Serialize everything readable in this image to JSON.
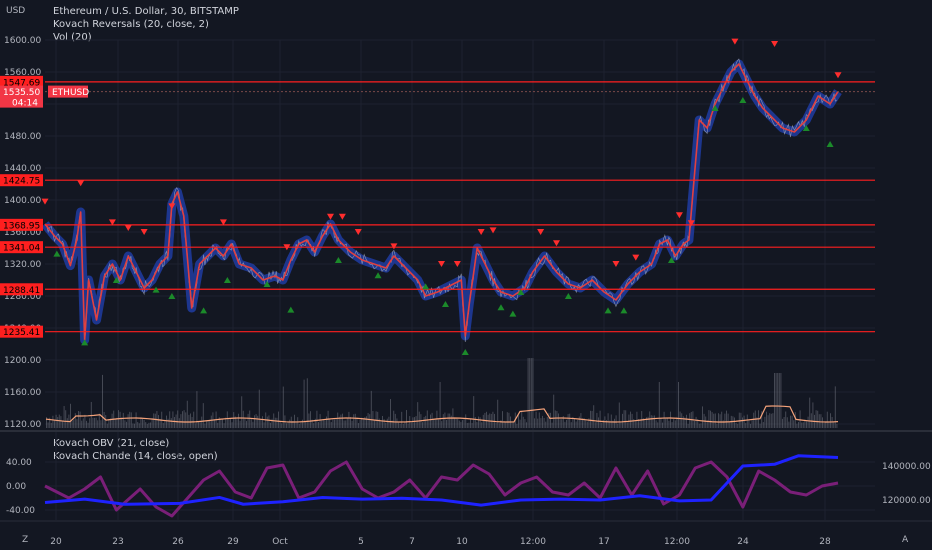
{
  "header": {
    "currency": "USD",
    "symbol_line": "Ethereum / U.S. Dollar, 30, BITSTAMP",
    "indicator_1": "Kovach Reversals (20, close, 2)",
    "indicator_2": "Vol (20)",
    "lower_indicator_1": "Kovach OBV (21, close)",
    "lower_indicator_2": "Kovach Chande (14, close, open)"
  },
  "footer": {
    "left_icon_label": "Z",
    "right_icon_label": "A"
  },
  "colors": {
    "background": "#131722",
    "grid": "#1e2230",
    "axis_text": "#b2b5be",
    "level_line": "#ff1f1f",
    "price_line": "#e04040",
    "band": "#1f3a9a",
    "down_marker": "#ff2d2d",
    "up_marker": "#1b8a2a",
    "volume": "#787b86",
    "volume_ma": "#f5a27a",
    "obv_line": "#1e22ff",
    "chande_line": "#7a1f78"
  },
  "chart_data": [
    {
      "type": "line",
      "title": "Ethereum / U.S. Dollar, 30, BITSTAMP",
      "ylabel": "USD",
      "ylim": [
        1120,
        1620
      ],
      "y_ticks": [
        "1600.00",
        "1560.00",
        "1520.00",
        "1480.00",
        "1440.00",
        "1400.00",
        "1360.00",
        "1320.00",
        "1280.00",
        "1240.00",
        "1200.00",
        "1160.00",
        "1120.00"
      ],
      "x_ticks": [
        "20",
        "23",
        "26",
        "29",
        "Oct",
        "5",
        "7",
        "10",
        "12:00",
        "17",
        "12:00",
        "24",
        "28"
      ],
      "horizontal_levels": [
        {
          "label": "1547.69",
          "value": 1547.69
        },
        {
          "label": "1424.75",
          "value": 1424.75
        },
        {
          "label": "1368.95",
          "value": 1368.95
        },
        {
          "label": "1341.04",
          "value": 1341.04
        },
        {
          "label": "1288.41",
          "value": 1288.41
        },
        {
          "label": "1235.41",
          "value": 1235.41
        }
      ],
      "last_price": {
        "symbol": "ETHUSD",
        "value": 1535.5,
        "label": "1535.50",
        "countdown": "04:14"
      },
      "series": [
        {
          "name": "ETHUSD",
          "points": [
            [
              0,
              1370
            ],
            [
              0.012,
              1355
            ],
            [
              0.022,
              1345
            ],
            [
              0.032,
              1318
            ],
            [
              0.04,
              1350
            ],
            [
              0.045,
              1385
            ],
            [
              0.05,
              1225
            ],
            [
              0.055,
              1300
            ],
            [
              0.065,
              1250
            ],
            [
              0.075,
              1305
            ],
            [
              0.085,
              1320
            ],
            [
              0.095,
              1300
            ],
            [
              0.105,
              1330
            ],
            [
              0.115,
              1310
            ],
            [
              0.125,
              1290
            ],
            [
              0.135,
              1300
            ],
            [
              0.145,
              1320
            ],
            [
              0.155,
              1330
            ],
            [
              0.16,
              1395
            ],
            [
              0.167,
              1410
            ],
            [
              0.175,
              1380
            ],
            [
              0.185,
              1265
            ],
            [
              0.195,
              1320
            ],
            [
              0.205,
              1330
            ],
            [
              0.215,
              1340
            ],
            [
              0.225,
              1330
            ],
            [
              0.235,
              1345
            ],
            [
              0.245,
              1320
            ],
            [
              0.26,
              1315
            ],
            [
              0.275,
              1300
            ],
            [
              0.29,
              1305
            ],
            [
              0.3,
              1300
            ],
            [
              0.31,
              1325
            ],
            [
              0.32,
              1345
            ],
            [
              0.33,
              1350
            ],
            [
              0.34,
              1335
            ],
            [
              0.35,
              1355
            ],
            [
              0.36,
              1370
            ],
            [
              0.37,
              1350
            ],
            [
              0.385,
              1335
            ],
            [
              0.4,
              1325
            ],
            [
              0.415,
              1320
            ],
            [
              0.43,
              1315
            ],
            [
              0.44,
              1330
            ],
            [
              0.455,
              1315
            ],
            [
              0.47,
              1300
            ],
            [
              0.48,
              1280
            ],
            [
              0.495,
              1285
            ],
            [
              0.505,
              1290
            ],
            [
              0.515,
              1295
            ],
            [
              0.525,
              1300
            ],
            [
              0.53,
              1230
            ],
            [
              0.535,
              1270
            ],
            [
              0.545,
              1340
            ],
            [
              0.555,
              1320
            ],
            [
              0.565,
              1300
            ],
            [
              0.575,
              1285
            ],
            [
              0.59,
              1280
            ],
            [
              0.605,
              1290
            ],
            [
              0.615,
              1310
            ],
            [
              0.63,
              1330
            ],
            [
              0.645,
              1310
            ],
            [
              0.66,
              1295
            ],
            [
              0.675,
              1290
            ],
            [
              0.69,
              1300
            ],
            [
              0.705,
              1285
            ],
            [
              0.72,
              1275
            ],
            [
              0.735,
              1295
            ],
            [
              0.75,
              1310
            ],
            [
              0.765,
              1320
            ],
            [
              0.775,
              1345
            ],
            [
              0.785,
              1350
            ],
            [
              0.795,
              1330
            ],
            [
              0.805,
              1345
            ],
            [
              0.812,
              1350
            ],
            [
              0.818,
              1420
            ],
            [
              0.825,
              1500
            ],
            [
              0.835,
              1490
            ],
            [
              0.845,
              1520
            ],
            [
              0.855,
              1540
            ],
            [
              0.865,
              1560
            ],
            [
              0.875,
              1570
            ],
            [
              0.885,
              1550
            ],
            [
              0.895,
              1530
            ],
            [
              0.905,
              1515
            ],
            [
              0.915,
              1505
            ],
            [
              0.93,
              1490
            ],
            [
              0.945,
              1485
            ],
            [
              0.96,
              1500
            ],
            [
              0.975,
              1530
            ],
            [
              0.99,
              1520
            ],
            [
              1,
              1535.5
            ]
          ]
        }
      ],
      "markers": {
        "down": [
          [
            0,
            1398
          ],
          [
            0.045,
            1421
          ],
          [
            0.085,
            1372
          ],
          [
            0.105,
            1365
          ],
          [
            0.125,
            1360
          ],
          [
            0.16,
            1392
          ],
          [
            0.225,
            1372
          ],
          [
            0.305,
            1341
          ],
          [
            0.36,
            1379
          ],
          [
            0.375,
            1379
          ],
          [
            0.395,
            1360
          ],
          [
            0.44,
            1342
          ],
          [
            0.5,
            1320
          ],
          [
            0.52,
            1320
          ],
          [
            0.55,
            1360
          ],
          [
            0.565,
            1362
          ],
          [
            0.625,
            1360
          ],
          [
            0.645,
            1346
          ],
          [
            0.72,
            1320
          ],
          [
            0.745,
            1328
          ],
          [
            0.8,
            1381
          ],
          [
            0.815,
            1371
          ],
          [
            0.87,
            1598
          ],
          [
            0.92,
            1595
          ],
          [
            1,
            1556
          ]
        ],
        "up": [
          [
            0.015,
            1333
          ],
          [
            0.05,
            1222
          ],
          [
            0.09,
            1300
          ],
          [
            0.14,
            1288
          ],
          [
            0.16,
            1280
          ],
          [
            0.2,
            1262
          ],
          [
            0.23,
            1300
          ],
          [
            0.28,
            1295
          ],
          [
            0.31,
            1263
          ],
          [
            0.37,
            1325
          ],
          [
            0.42,
            1306
          ],
          [
            0.48,
            1292
          ],
          [
            0.505,
            1270
          ],
          [
            0.53,
            1210
          ],
          [
            0.575,
            1266
          ],
          [
            0.59,
            1258
          ],
          [
            0.6,
            1285
          ],
          [
            0.66,
            1280
          ],
          [
            0.71,
            1262
          ],
          [
            0.73,
            1262
          ],
          [
            0.79,
            1325
          ],
          [
            0.845,
            1515
          ],
          [
            0.88,
            1525
          ],
          [
            0.96,
            1490
          ],
          [
            0.99,
            1470
          ]
        ]
      }
    },
    {
      "type": "bar",
      "title": "Vol (20)",
      "note": "volume histogram with moving average; no printed scale"
    },
    {
      "type": "line",
      "title": "Kovach OBV (21, close) / Kovach Chande (14, close, open)",
      "left_ylim": [
        -60,
        60
      ],
      "left_ticks": [
        "40.00",
        "0.00",
        "-40.00"
      ],
      "right_ylim": [
        104000,
        156000
      ],
      "right_ticks": [
        "140000.00",
        "120000.00"
      ],
      "series": [
        {
          "name": "Kovach OBV (21, close)",
          "axis": "right",
          "points": [
            [
              0,
              118500
            ],
            [
              0.05,
              120500
            ],
            [
              0.1,
              117500
            ],
            [
              0.17,
              118000
            ],
            [
              0.22,
              121500
            ],
            [
              0.25,
              117500
            ],
            [
              0.3,
              119000
            ],
            [
              0.35,
              121500
            ],
            [
              0.4,
              120500
            ],
            [
              0.45,
              121000
            ],
            [
              0.5,
              120000
            ],
            [
              0.55,
              117000
            ],
            [
              0.6,
              120000
            ],
            [
              0.65,
              120500
            ],
            [
              0.7,
              120000
            ],
            [
              0.75,
              122500
            ],
            [
              0.8,
              119500
            ],
            [
              0.84,
              120000
            ],
            [
              0.88,
              140000
            ],
            [
              0.92,
              141000
            ],
            [
              0.95,
              146000
            ],
            [
              1,
              145000
            ]
          ]
        },
        {
          "name": "Kovach Chande (14, close, open)",
          "axis": "left",
          "points": [
            [
              0,
              0
            ],
            [
              0.03,
              -20
            ],
            [
              0.05,
              -5
            ],
            [
              0.07,
              15
            ],
            [
              0.09,
              -40
            ],
            [
              0.12,
              -5
            ],
            [
              0.14,
              -35
            ],
            [
              0.16,
              -50
            ],
            [
              0.18,
              -20
            ],
            [
              0.2,
              10
            ],
            [
              0.22,
              25
            ],
            [
              0.24,
              -10
            ],
            [
              0.26,
              -20
            ],
            [
              0.28,
              30
            ],
            [
              0.3,
              35
            ],
            [
              0.32,
              -20
            ],
            [
              0.34,
              -10
            ],
            [
              0.36,
              25
            ],
            [
              0.38,
              40
            ],
            [
              0.4,
              -5
            ],
            [
              0.42,
              -20
            ],
            [
              0.44,
              -10
            ],
            [
              0.46,
              10
            ],
            [
              0.48,
              -20
            ],
            [
              0.5,
              15
            ],
            [
              0.52,
              10
            ],
            [
              0.54,
              35
            ],
            [
              0.56,
              20
            ],
            [
              0.58,
              -15
            ],
            [
              0.6,
              5
            ],
            [
              0.62,
              15
            ],
            [
              0.64,
              -10
            ],
            [
              0.66,
              -15
            ],
            [
              0.68,
              5
            ],
            [
              0.7,
              -20
            ],
            [
              0.72,
              30
            ],
            [
              0.74,
              -15
            ],
            [
              0.76,
              25
            ],
            [
              0.78,
              -30
            ],
            [
              0.8,
              -15
            ],
            [
              0.82,
              30
            ],
            [
              0.84,
              40
            ],
            [
              0.86,
              15
            ],
            [
              0.88,
              -35
            ],
            [
              0.9,
              25
            ],
            [
              0.92,
              10
            ],
            [
              0.94,
              -10
            ],
            [
              0.96,
              -15
            ],
            [
              0.98,
              0
            ],
            [
              1,
              5
            ]
          ]
        }
      ]
    }
  ]
}
